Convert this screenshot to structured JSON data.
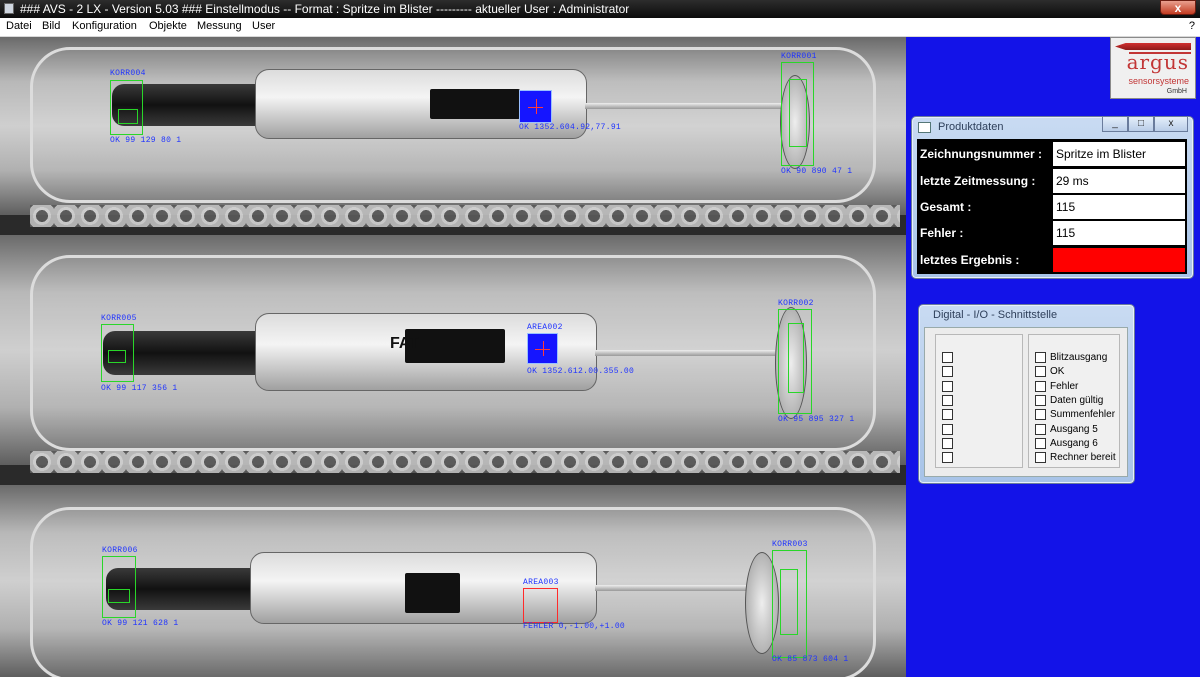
{
  "window": {
    "title": "### AVS - 2 LX - Version 5.03 ###  Einstellmodus -- Format : Spritze im Blister --------- aktueller User : Administrator",
    "close_label": "x"
  },
  "menu": {
    "items": [
      "Datei",
      "Bild",
      "Konfiguration",
      "Objekte",
      "Messung",
      "User"
    ],
    "help": "?"
  },
  "camera": {
    "label_fat": "FAT",
    "overlays": {
      "korr001": {
        "name": "KORR001",
        "result": "OK 90 890 47 1"
      },
      "korr002": {
        "name": "KORR002",
        "result": "OK 95 895 327 1"
      },
      "korr003": {
        "name": "KORR003",
        "result": "OK 85 873 604 1"
      },
      "korr004": {
        "name": "KORR004",
        "result": "OK 99 129 80 1"
      },
      "korr005": {
        "name": "KORR005",
        "result": "OK 99 117 356 1"
      },
      "korr006": {
        "name": "KORR006",
        "result": "OK 99 121 628 1"
      },
      "area001": {
        "name": "AREA001",
        "result": "OK 1352.604.92,77.91"
      },
      "area002": {
        "name": "AREA002",
        "result": "OK 1352.612.00.355.00"
      },
      "area003": {
        "name": "AREA003",
        "result": "FEHLER 0,-1.00,+1.00"
      }
    }
  },
  "logo": {
    "name": "argus",
    "line1": "sensorsysteme",
    "line2": "GmbH"
  },
  "produktdaten": {
    "title": "Produktdaten",
    "controls": [
      "_",
      "□",
      "x"
    ],
    "rows": [
      {
        "label": "Zeichnungsnummer  :",
        "value": "Spritze im Blister"
      },
      {
        "label": "letzte Zeitmessung :",
        "value": "29 ms"
      },
      {
        "label": "Gesamt :",
        "value": "115"
      },
      {
        "label": "Fehler :",
        "value": "115"
      },
      {
        "label": "letztes Ergebnis :",
        "value": ""
      }
    ],
    "result_color": "#ff0000"
  },
  "digital_io": {
    "title": "Digital - I/O - Schnittstelle",
    "inputs_count_label": "",
    "outputs": [
      "Blitzausgang",
      "OK",
      "Fehler",
      "Daten gültig",
      "Summenfehler",
      "Ausgang 5",
      "Ausgang 6",
      "Rechner bereit"
    ]
  },
  "colors": {
    "background": "#1313e8",
    "overlay_box": "#29d629",
    "overlay_text": "#1f33ff",
    "error": "#ff2a2a"
  }
}
